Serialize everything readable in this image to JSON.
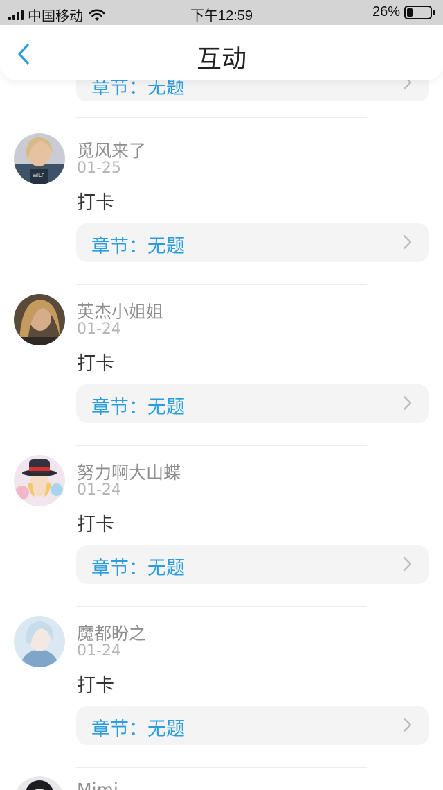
{
  "status_bar": {
    "carrier": "中国移动",
    "time": "下午12:59",
    "battery_percent_text": "26%",
    "battery_level": 0.26,
    "signal_icon": "signal-bars-icon",
    "wifi_icon": "wifi-icon",
    "battery_icon": "battery-icon"
  },
  "nav": {
    "title": "互动",
    "back_icon": "chevron-left-icon",
    "accent_color": "#2a9ddf"
  },
  "partial_top_chapter": {
    "label": "章节：无题"
  },
  "items": [
    {
      "user": "觅风来了",
      "date": "01-25",
      "text": "打卡",
      "chapter": "章节：无题"
    },
    {
      "user": "英杰小姐姐",
      "date": "01-24",
      "text": "打卡",
      "chapter": "章节：无题"
    },
    {
      "user": "努力啊大山蝶",
      "date": "01-24",
      "text": "打卡",
      "chapter": "章节：无题"
    },
    {
      "user": "魔都盼之",
      "date": "01-24",
      "text": "打卡",
      "chapter": "章节：无题"
    }
  ],
  "partial_bottom_item": {
    "user": "Mimi"
  }
}
